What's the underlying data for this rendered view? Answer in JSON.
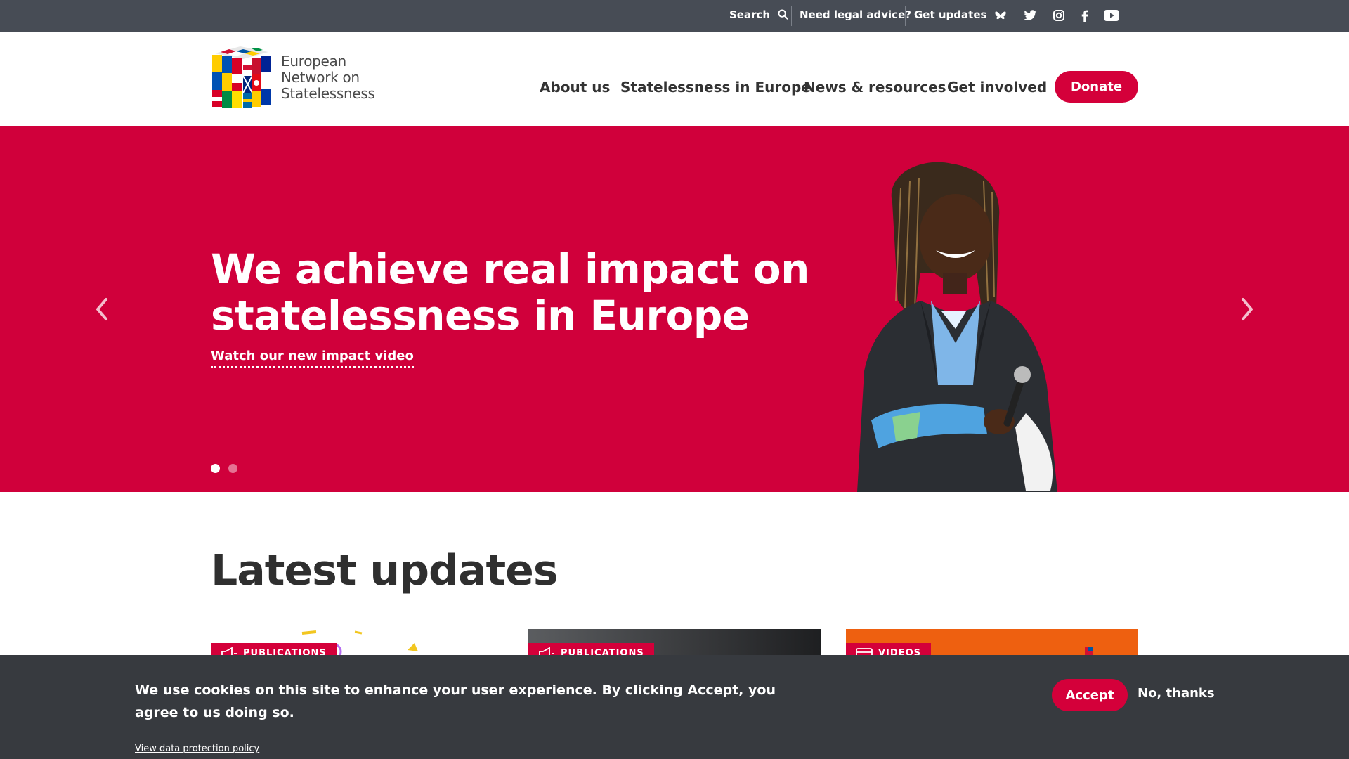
{
  "topbar": {
    "search_label": "Search",
    "legal_advice": "Need legal advice?",
    "get_updates": "Get updates",
    "social_icons": [
      "bluesky-icon",
      "twitter-icon",
      "instagram-icon",
      "facebook-icon",
      "youtube-icon"
    ]
  },
  "header": {
    "logo_lines": [
      "European",
      "Network on",
      "Statelessness"
    ],
    "nav": [
      "About us",
      "Statelessness in Europe",
      "News & resources",
      "Get involved"
    ],
    "donate_label": "Donate"
  },
  "hero": {
    "title_line1": "We achieve real impact on",
    "title_line2": "statelessness in Europe",
    "link_label": "Watch our new impact video",
    "slides_total": 2,
    "active_slide": 1
  },
  "latest": {
    "title": "Latest updates",
    "cards": [
      {
        "tag": "PUBLICATIONS",
        "icon": "megaphone-icon"
      },
      {
        "tag": "PUBLICATIONS",
        "icon": "megaphone-icon"
      },
      {
        "tag": "VIDEOS",
        "icon": "video-icon"
      }
    ]
  },
  "cookie": {
    "message": "We use cookies on this site to enhance your user experience. By clicking Accept, you agree to us doing so.",
    "policy_link": "View data protection policy",
    "accept_label": "Accept",
    "decline_label": "No, thanks"
  },
  "colors": {
    "brand_red": "#d4003a",
    "hero_bg": "#d0003b",
    "topbar_bg": "#474c55",
    "cookie_bg": "#373a3f"
  }
}
